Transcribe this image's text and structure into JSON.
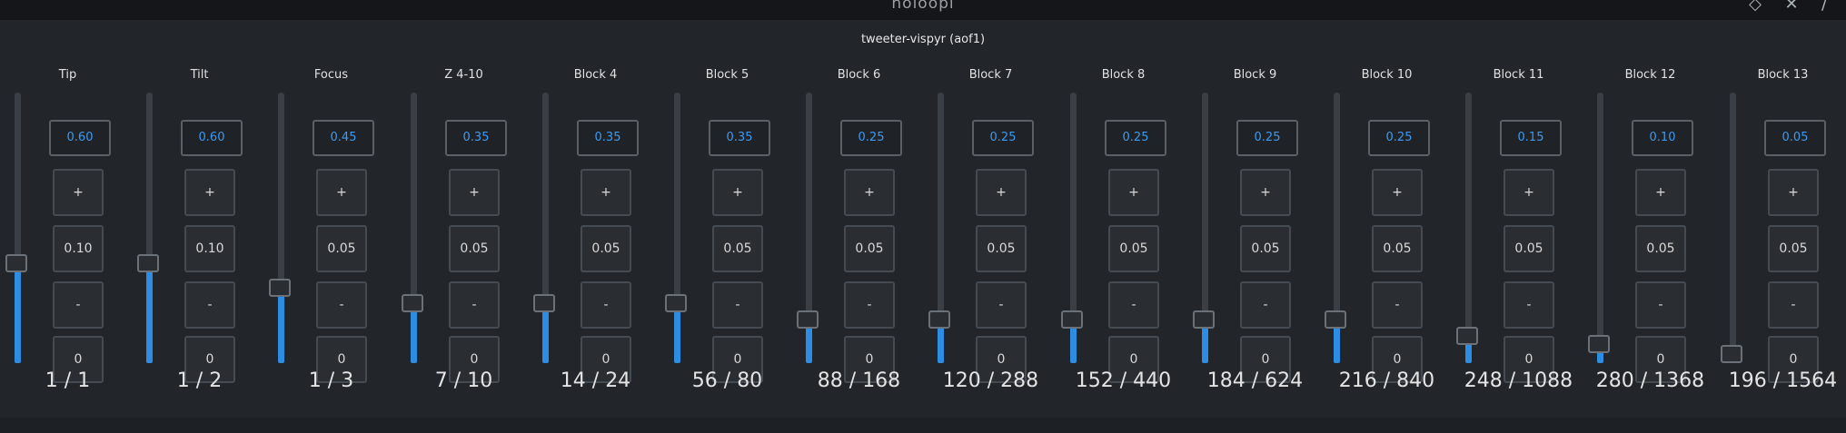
{
  "window": {
    "title": "holoopi",
    "controls": {
      "pin_icon": "pin-icon",
      "close_icon": "close-icon",
      "overflow_icon": "slash-icon"
    }
  },
  "panel": {
    "title": "tweeter-vispyr (aof1)"
  },
  "colors": {
    "accent": "#2d8de2",
    "value_text": "#3d9af0",
    "background": "#22262b"
  },
  "channels": [
    {
      "label": "Tip",
      "value": "0.60",
      "step": "0.10",
      "plus": "+",
      "minus": "-",
      "zero": "0",
      "ratio": "1 / 1",
      "level": 0.37
    },
    {
      "label": "Tilt",
      "value": "0.60",
      "step": "0.10",
      "plus": "+",
      "minus": "-",
      "zero": "0",
      "ratio": "1 / 2",
      "level": 0.37
    },
    {
      "label": "Focus",
      "value": "0.45",
      "step": "0.05",
      "plus": "+",
      "minus": "-",
      "zero": "0",
      "ratio": "1 / 3",
      "level": 0.28
    },
    {
      "label": "Z 4-10",
      "value": "0.35",
      "step": "0.05",
      "plus": "+",
      "minus": "-",
      "zero": "0",
      "ratio": "7 / 10",
      "level": 0.22
    },
    {
      "label": "Block 4",
      "value": "0.35",
      "step": "0.05",
      "plus": "+",
      "minus": "-",
      "zero": "0",
      "ratio": "14 / 24",
      "level": 0.22
    },
    {
      "label": "Block 5",
      "value": "0.35",
      "step": "0.05",
      "plus": "+",
      "minus": "-",
      "zero": "0",
      "ratio": "56 / 80",
      "level": 0.22
    },
    {
      "label": "Block 6",
      "value": "0.25",
      "step": "0.05",
      "plus": "+",
      "minus": "-",
      "zero": "0",
      "ratio": "88 / 168",
      "level": 0.16
    },
    {
      "label": "Block 7",
      "value": "0.25",
      "step": "0.05",
      "plus": "+",
      "minus": "-",
      "zero": "0",
      "ratio": "120 / 288",
      "level": 0.16
    },
    {
      "label": "Block 8",
      "value": "0.25",
      "step": "0.05",
      "plus": "+",
      "minus": "-",
      "zero": "0",
      "ratio": "152 / 440",
      "level": 0.16
    },
    {
      "label": "Block 9",
      "value": "0.25",
      "step": "0.05",
      "plus": "+",
      "minus": "-",
      "zero": "0",
      "ratio": "184 / 624",
      "level": 0.16
    },
    {
      "label": "Block 10",
      "value": "0.25",
      "step": "0.05",
      "plus": "+",
      "minus": "-",
      "zero": "0",
      "ratio": "216 / 840",
      "level": 0.16
    },
    {
      "label": "Block 11",
      "value": "0.15",
      "step": "0.05",
      "plus": "+",
      "minus": "-",
      "zero": "0",
      "ratio": "248 / 1088",
      "level": 0.1
    },
    {
      "label": "Block 12",
      "value": "0.10",
      "step": "0.05",
      "plus": "+",
      "minus": "-",
      "zero": "0",
      "ratio": "280 / 1368",
      "level": 0.07
    },
    {
      "label": "Block 13",
      "value": "0.05",
      "step": "0.05",
      "plus": "+",
      "minus": "-",
      "zero": "0",
      "ratio": "196 / 1564",
      "level": 0.035
    }
  ]
}
